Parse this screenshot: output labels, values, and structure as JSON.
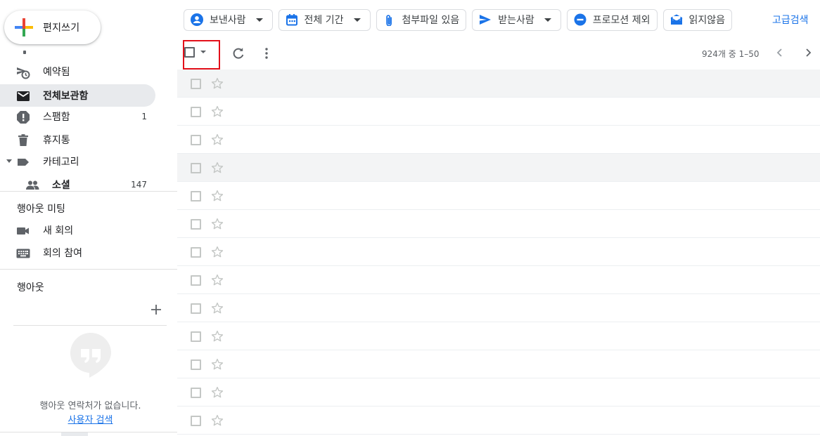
{
  "compose": {
    "label": "편지쓰기"
  },
  "sidebar": {
    "items": [
      {
        "label": "예약됨",
        "count": "",
        "icon": "scheduled-send-icon"
      },
      {
        "label": "전체보관함",
        "count": "",
        "icon": "all-mail-icon",
        "active": true
      },
      {
        "label": "스팸함",
        "count": "1",
        "icon": "spam-icon"
      },
      {
        "label": "휴지통",
        "count": "",
        "icon": "trash-icon"
      },
      {
        "label": "카테고리",
        "count": "",
        "icon": "label-icon"
      },
      {
        "label": "소셜",
        "count": "147",
        "icon": "people-icon"
      }
    ],
    "meet": {
      "title": "행아웃 미팅",
      "new_meeting": "새 회의",
      "join_meeting": "회의 참여"
    },
    "hangouts": {
      "title": "행아웃",
      "empty_text": "행아웃 연락처가 없습니다.",
      "search_link": "사용자 검색"
    }
  },
  "filters": {
    "chips": [
      {
        "label": "보낸사람",
        "icon": "person-icon",
        "dropdown": true
      },
      {
        "label": "전체 기간",
        "icon": "calendar-icon",
        "dropdown": true
      },
      {
        "label": "첨부파일 있음",
        "icon": "attachment-icon",
        "dropdown": false
      },
      {
        "label": "받는사람",
        "icon": "send-icon",
        "dropdown": true
      },
      {
        "label": "프로모션 제외",
        "icon": "minus-circle-icon",
        "dropdown": false
      },
      {
        "label": "읽지않음",
        "icon": "unread-mail-icon",
        "dropdown": false
      }
    ],
    "advanced_search": "고급검색"
  },
  "toolbar": {
    "page_info": "924개 중 1–50"
  },
  "mail_rows": 13,
  "colors": {
    "accent": "#1a73e8",
    "highlight_border": "#e3101a",
    "active_bg": "#e8eaed"
  }
}
